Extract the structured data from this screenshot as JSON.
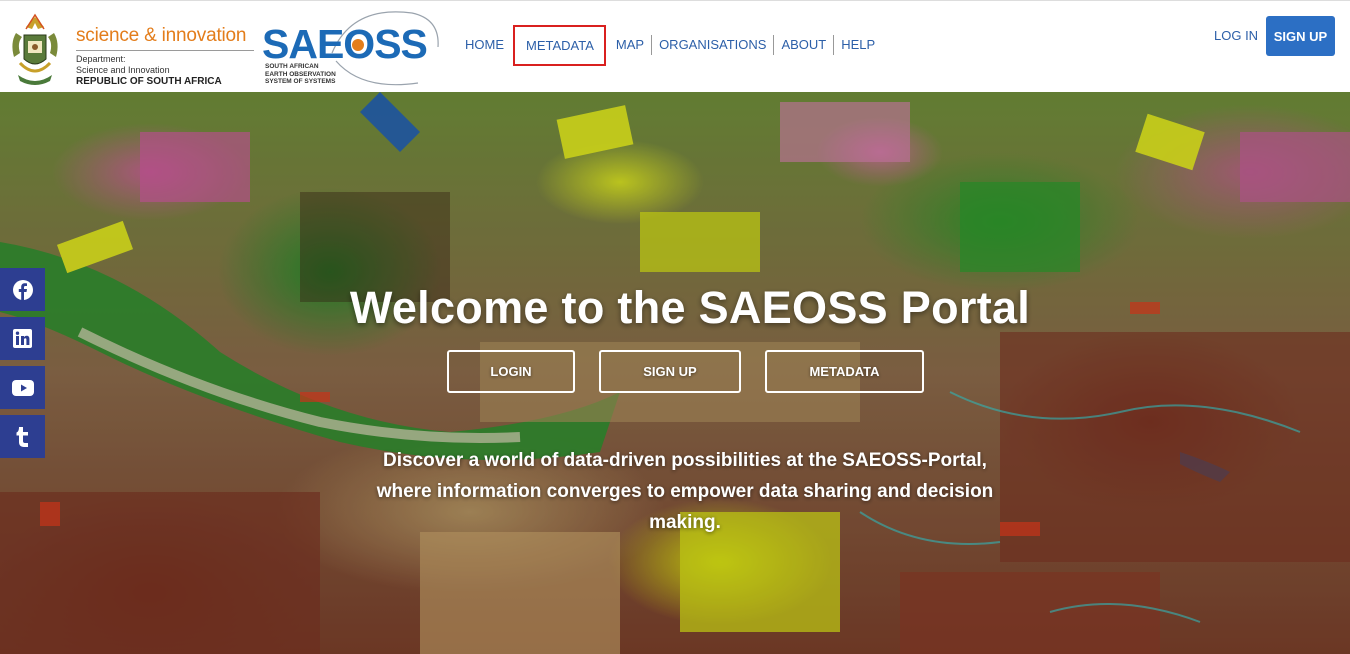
{
  "header": {
    "dept_logo": {
      "brand": "science & innovation",
      "department_line1": "Department:",
      "department_line2": "Science and Innovation",
      "country": "REPUBLIC OF SOUTH AFRICA"
    },
    "saeoss_logo": {
      "wordmark": "SAEOSS",
      "subtitle_line1": "SOUTH AFRICAN",
      "subtitle_line2": "EARTH OBSERVATION",
      "subtitle_line3": "SYSTEM OF SYSTEMS"
    },
    "nav": {
      "items": [
        {
          "label": "HOME"
        },
        {
          "label": "METADATA",
          "highlighted": true
        },
        {
          "label": "MAP"
        },
        {
          "label": "ORGANISATIONS"
        },
        {
          "label": "ABOUT"
        },
        {
          "label": "HELP"
        }
      ]
    },
    "auth": {
      "login_label": "LOG IN",
      "signup_label": "SIGN UP"
    },
    "colors": {
      "nav_text": "#2c5fa8",
      "signup_bg": "#2c6fc4",
      "highlight_border": "#d9201f",
      "brand_orange": "#e37d1b"
    }
  },
  "hero": {
    "title": "Welcome to the SAEOSS Portal",
    "buttons": {
      "login": "LOGIN",
      "signup": "SIGN UP",
      "metadata": "METADATA"
    },
    "description": "Discover a world of data-driven possibilities at the SAEOSS-Portal, where information converges to empower data sharing and decision making."
  },
  "social": {
    "icons": [
      "facebook-icon",
      "linkedin-icon",
      "youtube-icon",
      "tumblr-icon"
    ],
    "color": "#2d3e91"
  }
}
